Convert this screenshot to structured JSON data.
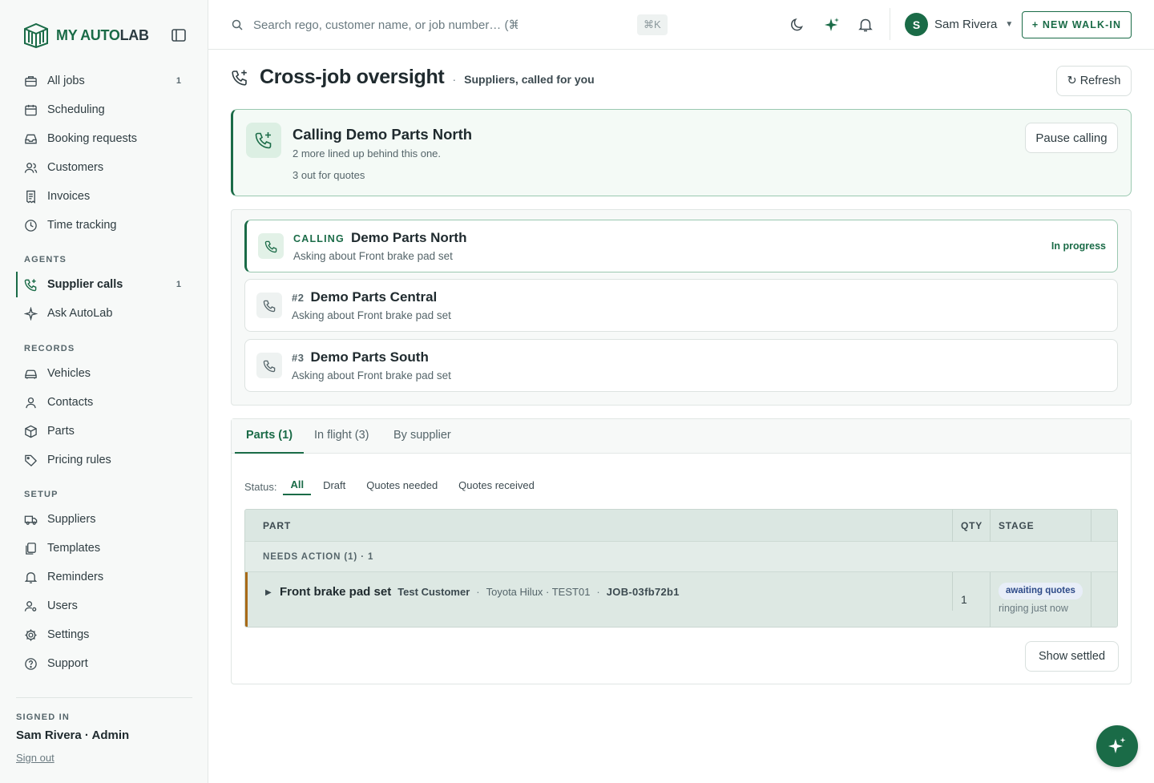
{
  "brand": {
    "name_part1": "MY AUTO",
    "name_part2": "LAB"
  },
  "sidebar": {
    "main_items": [
      {
        "label": "All jobs",
        "icon": "briefcase-icon",
        "count": "1"
      },
      {
        "label": "Scheduling",
        "icon": "calendar-icon"
      },
      {
        "label": "Booking requests",
        "icon": "inbox-icon"
      },
      {
        "label": "Customers",
        "icon": "users-icon"
      },
      {
        "label": "Invoices",
        "icon": "receipt-icon"
      },
      {
        "label": "Time tracking",
        "icon": "clock-icon"
      }
    ],
    "agents_label": "AGENTS",
    "agent_items": [
      {
        "label": "Supplier calls",
        "icon": "phone-plus-icon",
        "count": "1",
        "active": true
      },
      {
        "label": "Ask AutoLab",
        "icon": "sparkle-icon"
      }
    ],
    "records_label": "RECORDS",
    "record_items": [
      {
        "label": "Vehicles",
        "icon": "car-icon"
      },
      {
        "label": "Contacts",
        "icon": "user-icon"
      },
      {
        "label": "Parts",
        "icon": "box-icon"
      },
      {
        "label": "Pricing rules",
        "icon": "tag-icon"
      }
    ],
    "setup_label": "SETUP",
    "setup_items": [
      {
        "label": "Suppliers",
        "icon": "truck-icon"
      },
      {
        "label": "Templates",
        "icon": "copy-icon"
      },
      {
        "label": "Reminders",
        "icon": "bell-icon"
      },
      {
        "label": "Users",
        "icon": "user-cog-icon"
      },
      {
        "label": "Settings",
        "icon": "gear-icon"
      },
      {
        "label": "Support",
        "icon": "help-icon"
      }
    ],
    "signed_in_label": "SIGNED IN",
    "signed_in_user": "Sam Rivera · Admin",
    "sign_out": "Sign out"
  },
  "topbar": {
    "search_placeholder": "Search rego, customer name, or job number… (⌘K)",
    "shortcut": "⌘K",
    "user_initial": "S",
    "user_name": "Sam Rivera",
    "walkin_label": "+ NEW WALK-IN"
  },
  "page": {
    "title": "Cross-job oversight",
    "separator": "·",
    "subtitle": "Suppliers, called for you",
    "refresh_label": "↻ Refresh"
  },
  "current_call": {
    "title": "Calling Demo Parts North",
    "line1": "2 more lined up behind this one.",
    "line2": "3 out for quotes",
    "pause_label": "Pause calling"
  },
  "queue": [
    {
      "tag": "CALLING",
      "name": "Demo Parts North",
      "desc": "Asking about Front brake pad set",
      "status": "In progress"
    },
    {
      "tag": "#2",
      "name": "Demo Parts Central",
      "desc": "Asking about Front brake pad set"
    },
    {
      "tag": "#3",
      "name": "Demo Parts South",
      "desc": "Asking about Front brake pad set"
    }
  ],
  "tabs": [
    {
      "label": "Parts (1)",
      "active": true
    },
    {
      "label": "In flight (3)"
    },
    {
      "label": "By supplier"
    }
  ],
  "status_filter": {
    "label": "Status:",
    "options": [
      "All",
      "Draft",
      "Quotes needed",
      "Quotes received"
    ],
    "selected": "All"
  },
  "table": {
    "headers": {
      "part": "PART",
      "qty": "QTY",
      "stage": "STAGE"
    },
    "group_label": "NEEDS ACTION (1) · 1",
    "rows": [
      {
        "part": "Front brake pad set",
        "customer": "Test Customer",
        "vehicle": "Toyota Hilux · TEST01",
        "job": "JOB-03fb72b1",
        "qty": "1",
        "stage": "awaiting quotes",
        "stage_sub": "ringing just now"
      }
    ]
  },
  "show_settled_label": "Show settled",
  "colors": {
    "accent": "#1a6b47",
    "warning_accent": "#a86a18"
  }
}
